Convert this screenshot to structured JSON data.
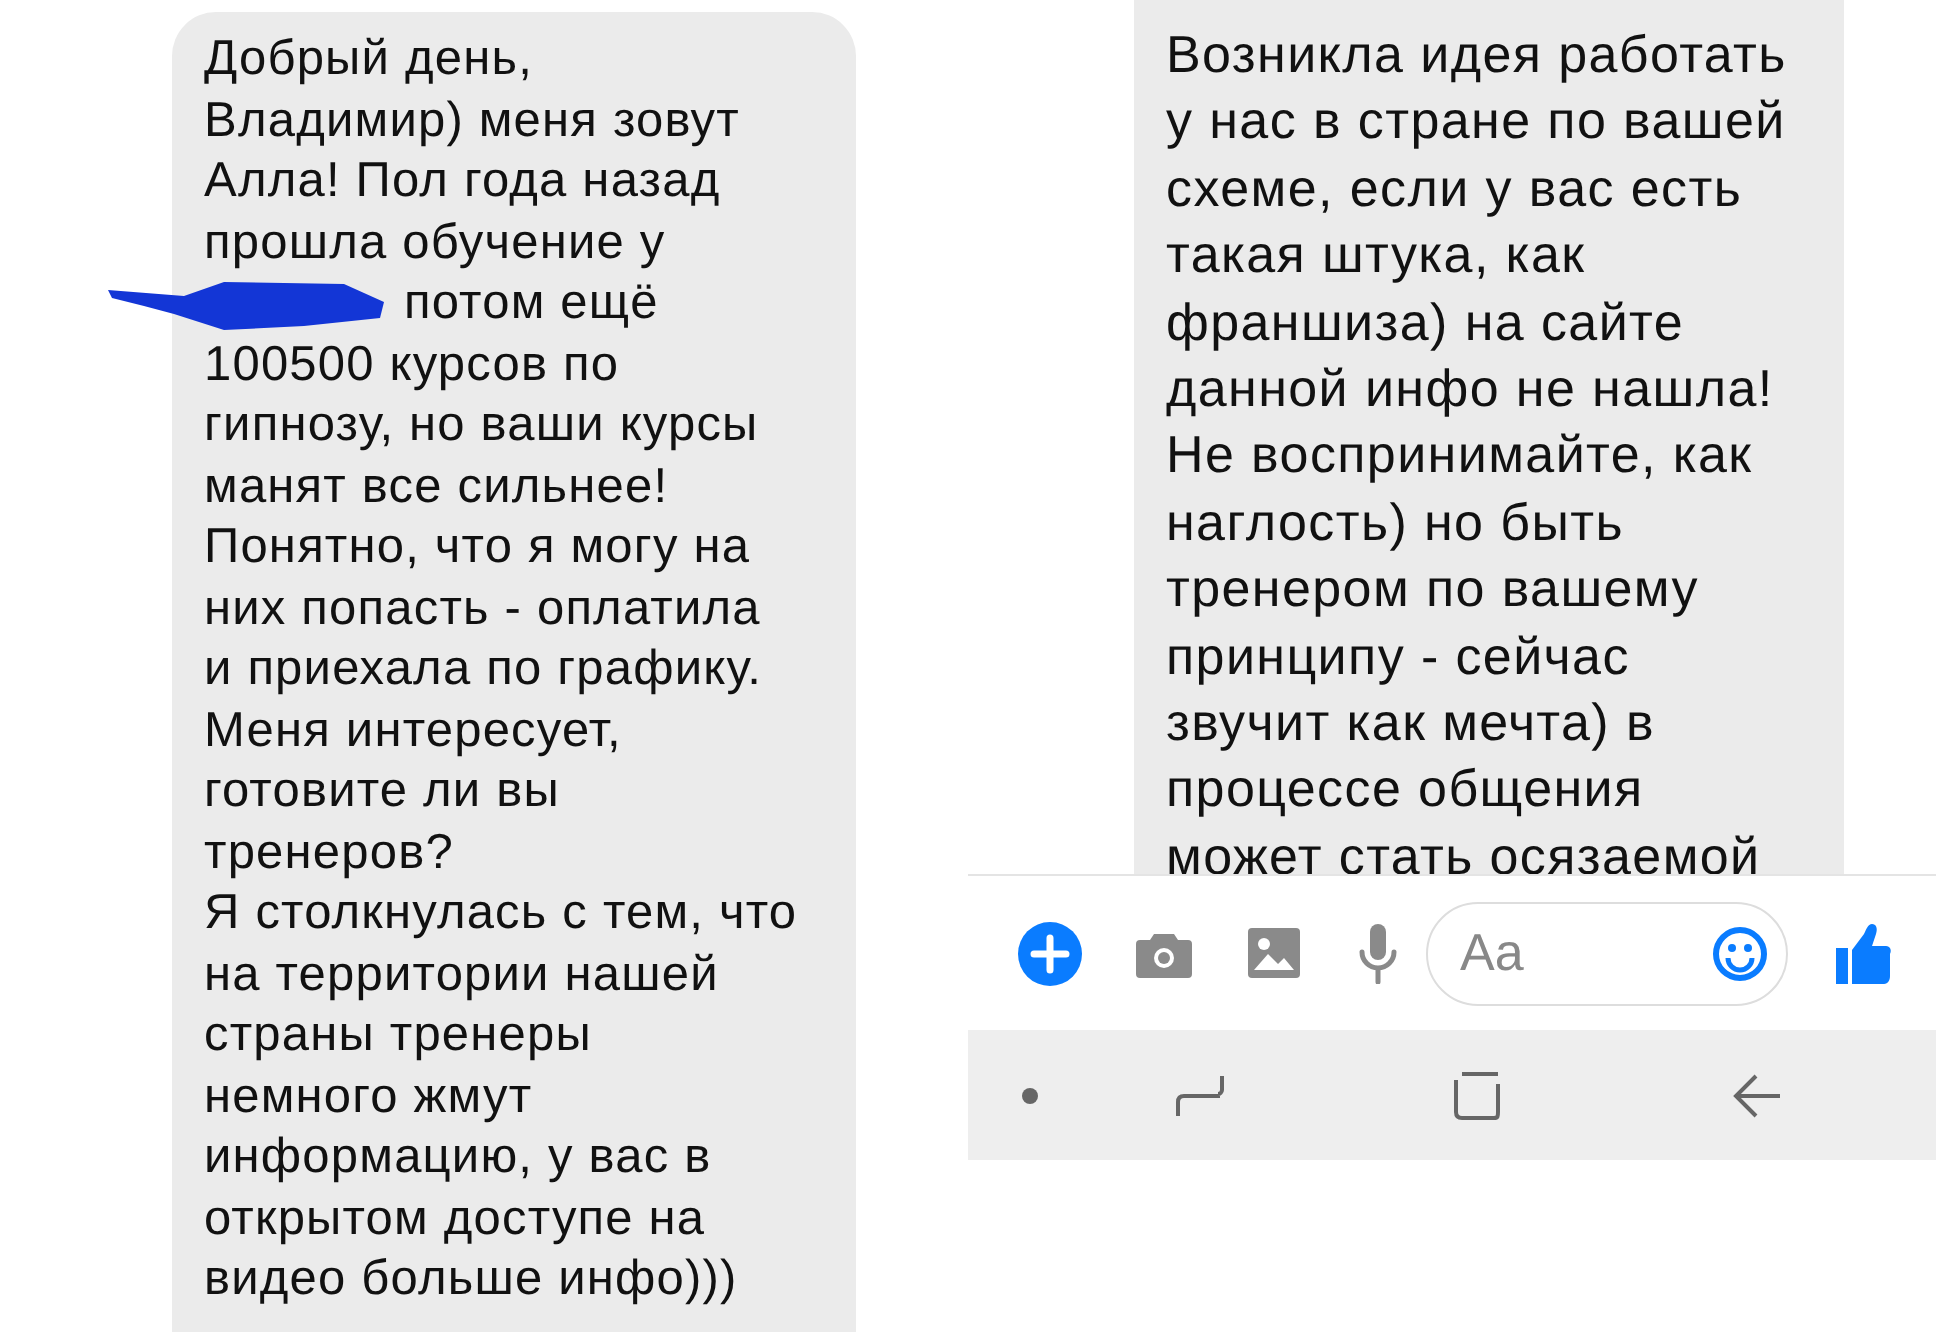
{
  "left_message": {
    "lines": [
      {
        "text": "Добрый день,",
        "redacted": false
      },
      {
        "text": "Владимир) меня зовут",
        "redacted": false
      },
      {
        "text": "Алла! Пол года назад",
        "redacted": false
      },
      {
        "text": "прошла обучение у",
        "redacted": false
      },
      {
        "text": "потом ещё",
        "redacted": true
      },
      {
        "text": "100500 курсов по",
        "redacted": false
      },
      {
        "text": "гипнозу, но ваши курсы",
        "redacted": false
      },
      {
        "text": "манят все сильнее!",
        "redacted": false
      },
      {
        "text": "Понятно, что я могу на",
        "redacted": false
      },
      {
        "text": "них попасть - оплатила",
        "redacted": false
      },
      {
        "text": "и приехала по графику.",
        "redacted": false
      },
      {
        "text": "Меня интересует,",
        "redacted": false
      },
      {
        "text": "готовите ли вы",
        "redacted": false
      },
      {
        "text": "тренеров?",
        "redacted": false
      },
      {
        "text": "Я столкнулась с тем, что",
        "redacted": false
      },
      {
        "text": "на территории нашей",
        "redacted": false
      },
      {
        "text": "страны тренеры",
        "redacted": false
      },
      {
        "text": "немного жмут",
        "redacted": false
      },
      {
        "text": "информацию, у вас в",
        "redacted": false
      },
      {
        "text": "открытом доступе на",
        "redacted": false
      },
      {
        "text": "видео больше инфо)))",
        "redacted": false
      }
    ]
  },
  "right_message": {
    "lines": [
      {
        "text": "Возникла идея работать",
        "redacted": false
      },
      {
        "text": "у нас в стране по вашей",
        "redacted": false
      },
      {
        "text": "схеме, если у вас есть",
        "redacted": false
      },
      {
        "text": "такая штука, как",
        "redacted": false
      },
      {
        "text": "франшиза) на сайте",
        "redacted": false
      },
      {
        "text": "данной инфо не нашла!",
        "redacted": false
      },
      {
        "text": "Не воспринимайте, как",
        "redacted": false
      },
      {
        "text": "наглость) но быть",
        "redacted": false
      },
      {
        "text": "тренером по вашему",
        "redacted": false
      },
      {
        "text": "принципу - сейчас",
        "redacted": false
      },
      {
        "text": "звучит как мечта) в",
        "redacted": false
      },
      {
        "text": "процессе общения",
        "redacted": false
      },
      {
        "text": "может стать осязаемой",
        "redacted": false
      }
    ]
  },
  "composer": {
    "placeholder": "Aa"
  }
}
